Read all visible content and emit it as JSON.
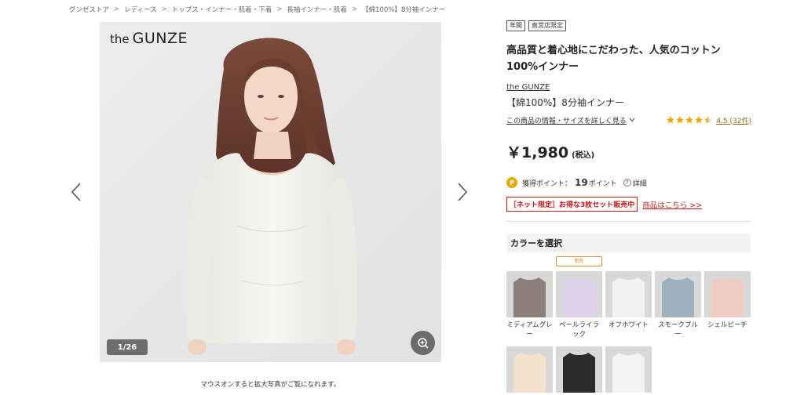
{
  "breadcrumb": [
    "グンゼストア",
    "レディース",
    "トップス・インナー・肌着・下着",
    "長袖インナー・肌着",
    "【綿100%】8分袖インナー"
  ],
  "breadcrumb_sep": ">",
  "gallery": {
    "logo_small": "the",
    "logo_big": "GUNZE",
    "counter": "1/26",
    "zoom_icon": "zoom-in-icon"
  },
  "caption": "マウスオンすると拡大写真がご覧になれます。",
  "product": {
    "badges": [
      "年間",
      "直営店限定"
    ],
    "title": "高品質と着心地にこだわった、人気のコットン100%インナー",
    "brand": "the GUNZE",
    "name": "【綿100%】8分袖インナー",
    "info_link": "この商品の情報・サイズを詳しく見る",
    "rating": 4.5,
    "rating_text": "4.5 (32件)",
    "price": "￥1,980",
    "tax": "(税込)",
    "points_label": "獲得ポイント：",
    "points_value": "19",
    "points_unit": "ポイント",
    "points_detail": "詳細",
    "points_icon_letter": "P",
    "set_banner": "［ネット限定］お得な3枚セット販売中",
    "set_link": "商品はこちら >>"
  },
  "color_section": {
    "header": "カラーを選択",
    "new_tag": "新色",
    "swatches": [
      {
        "label": "ミディアムグレー",
        "color": "#8c7f7c"
      },
      {
        "label": "ペールライラック",
        "color": "#ddd0ea"
      },
      {
        "label": "オフホワイト",
        "color": "#f4f2ee"
      },
      {
        "label": "スモークブルー",
        "color": "#9eb2bd"
      },
      {
        "label": "シェルピーチ",
        "color": "#f0cbc2"
      },
      {
        "label": "",
        "color": "#f2e1cb"
      },
      {
        "label": "",
        "color": "#2b2b2b"
      },
      {
        "label": "",
        "color": "#f4f4f4"
      }
    ]
  },
  "colors": {
    "accent_red": "#c41a1a",
    "star": "#e6a800",
    "new_tag": "#e58a2a"
  }
}
